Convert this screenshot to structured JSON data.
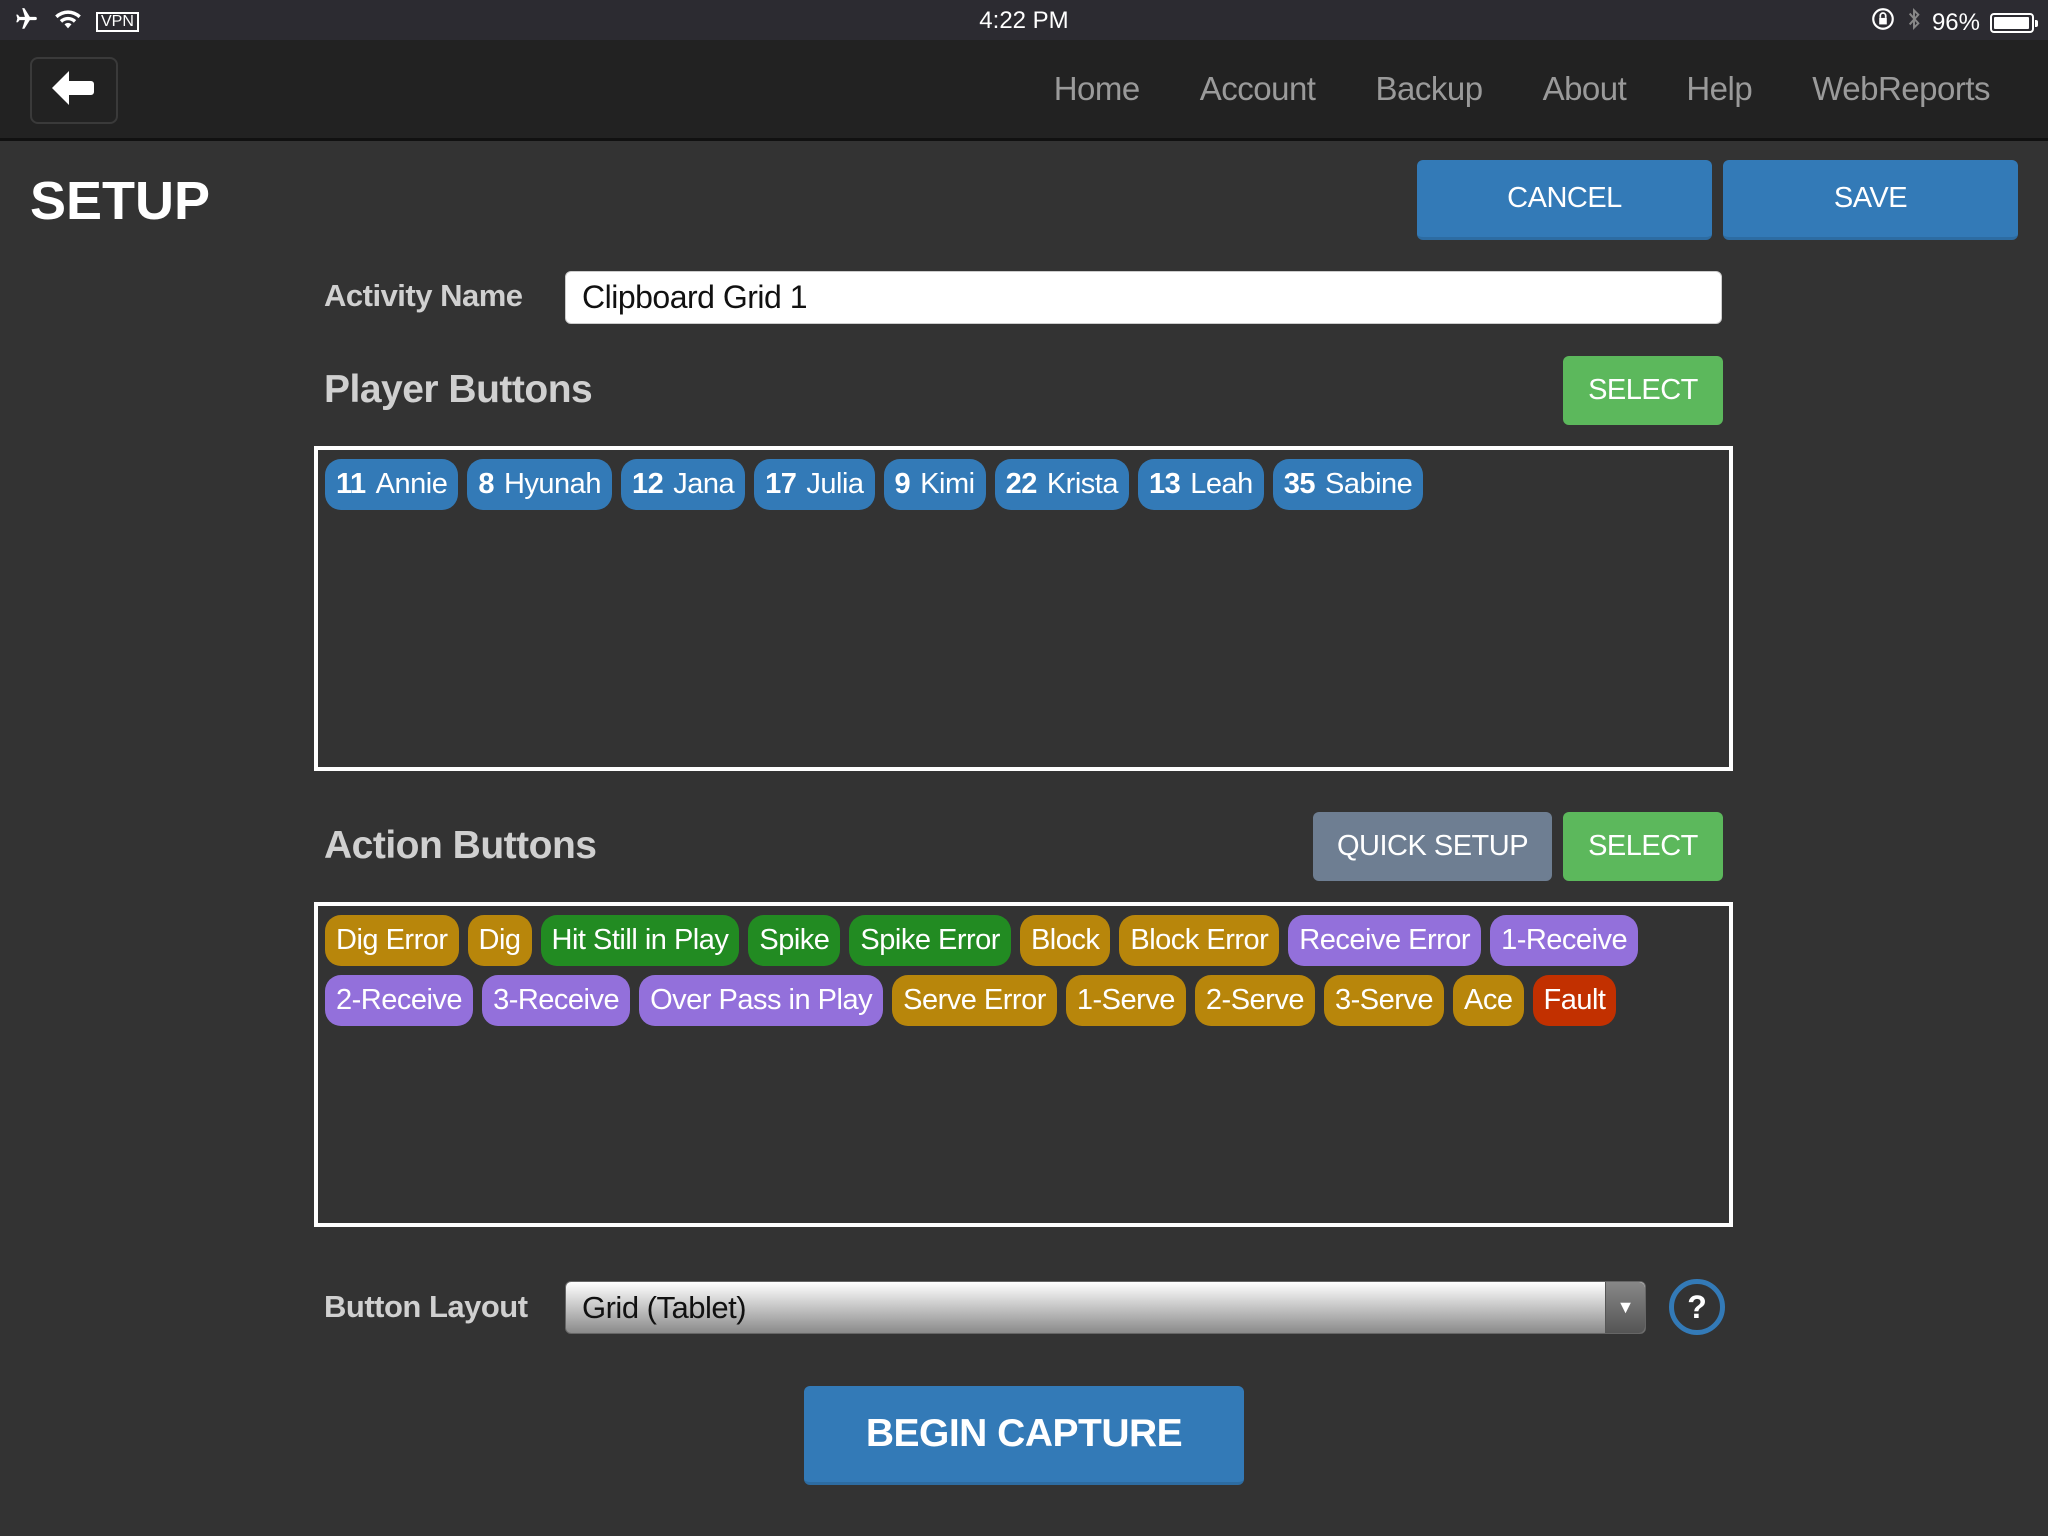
{
  "status_bar": {
    "vpn_label": "VPN",
    "time": "4:22 PM",
    "battery_percent_label": "96%",
    "battery_level": 0.96,
    "icons": [
      "airplane-icon",
      "wifi-icon",
      "rotation-lock-icon",
      "bluetooth-icon",
      "battery-icon"
    ]
  },
  "header": {
    "back_icon": "arrow-left-icon",
    "nav": [
      {
        "label": "Home"
      },
      {
        "label": "Account"
      },
      {
        "label": "Backup"
      },
      {
        "label": "About"
      },
      {
        "label": "Help"
      },
      {
        "label": "WebReports"
      }
    ]
  },
  "page": {
    "title": "SETUP",
    "cancel_label": "CANCEL",
    "save_label": "SAVE"
  },
  "activity": {
    "label": "Activity Name",
    "value": "Clipboard Grid 1"
  },
  "players": {
    "title": "Player Buttons",
    "select_label": "SELECT",
    "items": [
      {
        "number": "11",
        "name": "Annie"
      },
      {
        "number": "8",
        "name": "Hyunah"
      },
      {
        "number": "12",
        "name": "Jana"
      },
      {
        "number": "17",
        "name": "Julia"
      },
      {
        "number": "9",
        "name": "Kimi"
      },
      {
        "number": "22",
        "name": "Krista"
      },
      {
        "number": "13",
        "name": "Leah"
      },
      {
        "number": "35",
        "name": "Sabine"
      }
    ],
    "color": "#337ab7"
  },
  "actions": {
    "title": "Action Buttons",
    "quick_setup_label": "QUICK SETUP",
    "select_label": "SELECT",
    "colors": {
      "gold": "#b8860b",
      "green": "#228b22",
      "purple": "#9370db",
      "red": "#c23000"
    },
    "items": [
      {
        "label": "Dig Error",
        "color": "gold"
      },
      {
        "label": "Dig",
        "color": "gold"
      },
      {
        "label": "Hit Still in Play",
        "color": "green"
      },
      {
        "label": "Spike",
        "color": "green"
      },
      {
        "label": "Spike Error",
        "color": "green"
      },
      {
        "label": "Block",
        "color": "gold"
      },
      {
        "label": "Block Error",
        "color": "gold"
      },
      {
        "label": "Receive Error",
        "color": "purple"
      },
      {
        "label": "1-Receive",
        "color": "purple"
      },
      {
        "label": "2-Receive",
        "color": "purple"
      },
      {
        "label": "3-Receive",
        "color": "purple"
      },
      {
        "label": "Over Pass in Play",
        "color": "purple"
      },
      {
        "label": "Serve Error",
        "color": "gold"
      },
      {
        "label": "1-Serve",
        "color": "gold"
      },
      {
        "label": "2-Serve",
        "color": "gold"
      },
      {
        "label": "3-Serve",
        "color": "gold"
      },
      {
        "label": "Ace",
        "color": "gold"
      },
      {
        "label": "Fault",
        "color": "red"
      }
    ]
  },
  "layout": {
    "label": "Button Layout",
    "selected": "Grid (Tablet)",
    "help_label": "?"
  },
  "begin_capture_label": "BEGIN CAPTURE"
}
